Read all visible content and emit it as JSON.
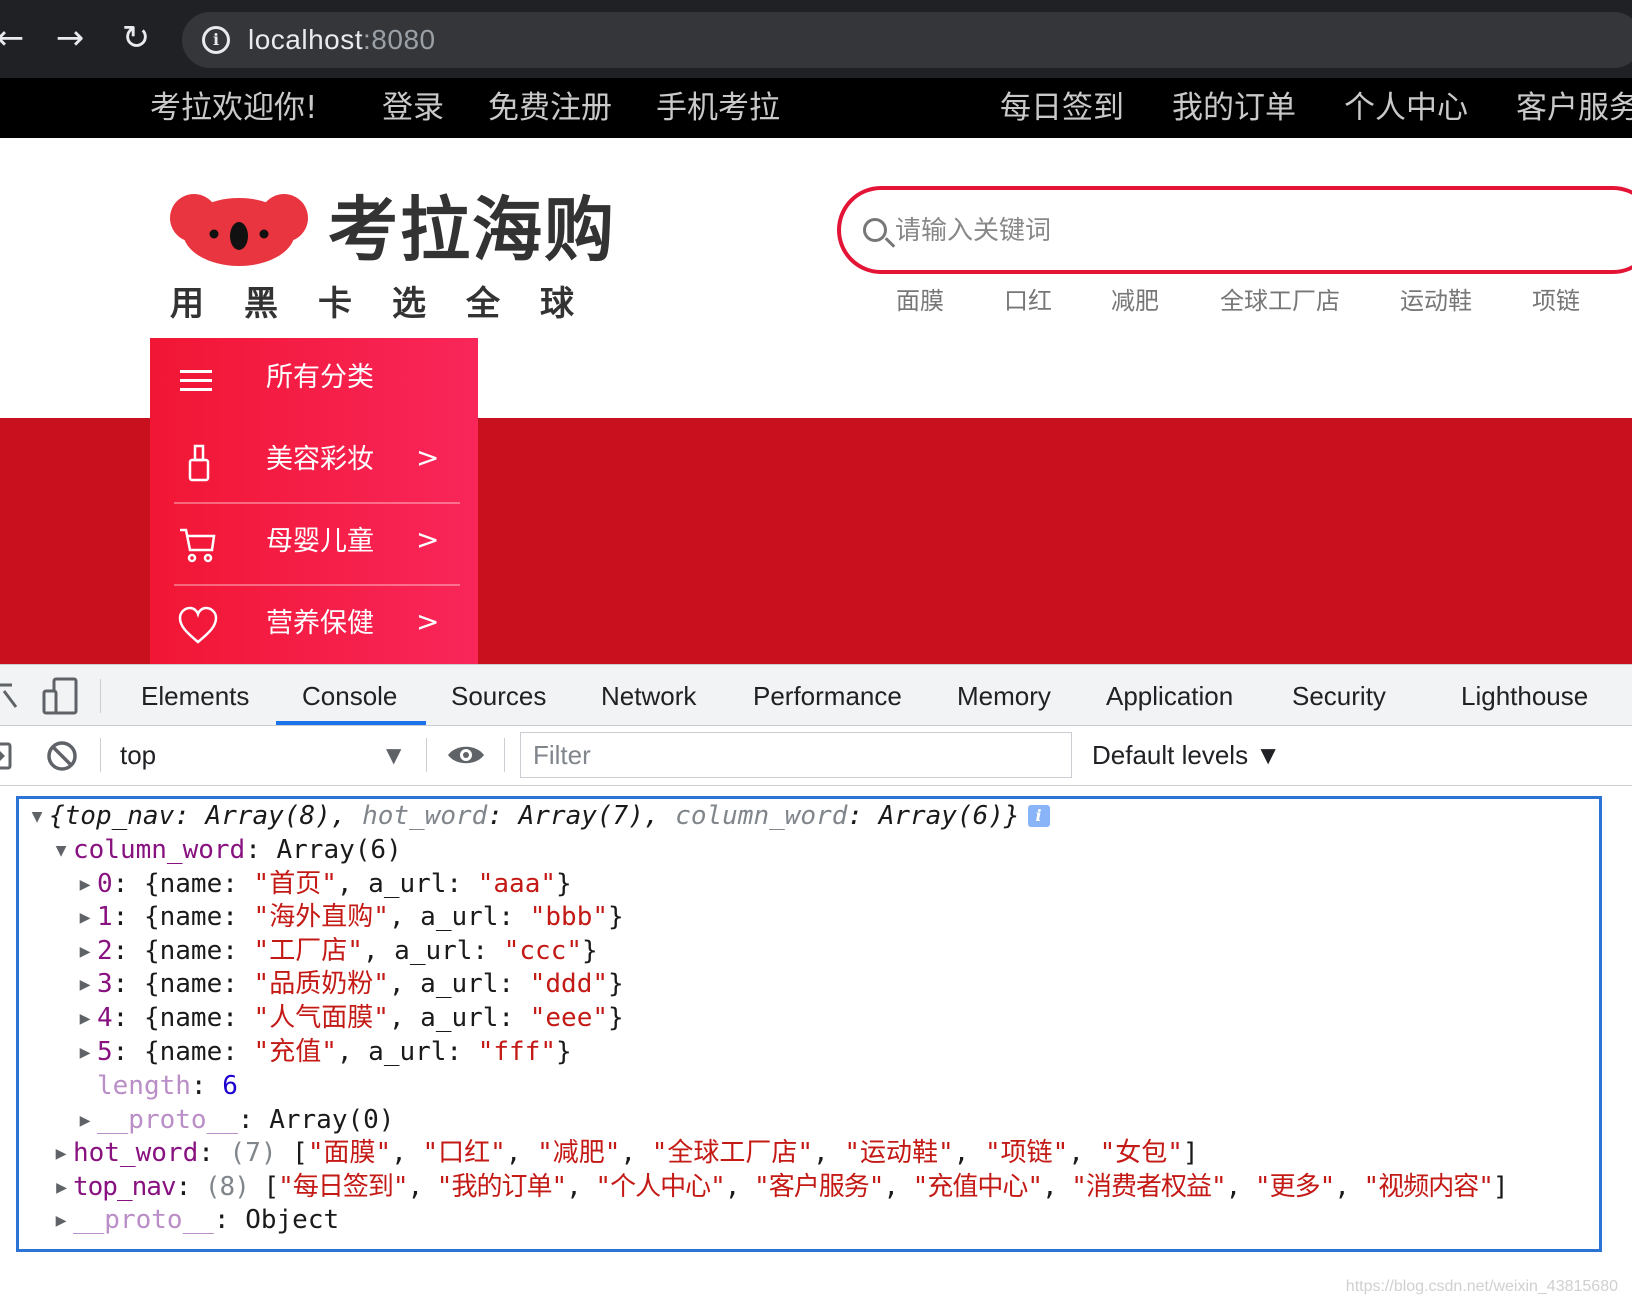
{
  "browser": {
    "url_host": "localhost",
    "url_port": ":8080"
  },
  "page": {
    "top_nav_left": [
      "考拉欢迎你!",
      "登录",
      "免费注册",
      "手机考拉"
    ],
    "top_nav_right": [
      "每日签到",
      "我的订单",
      "个人中心",
      "客户服务"
    ],
    "logo_title": "考拉海购",
    "logo_slogan": "用黑卡选全球",
    "search_placeholder": "请输入关键词",
    "hot_words": [
      "面膜",
      "口红",
      "减肥",
      "全球工厂店",
      "运动鞋",
      "项链"
    ],
    "category_title": "所有分类",
    "categories": [
      {
        "label": "美容彩妆",
        "icon": "bottle-icon"
      },
      {
        "label": "母婴儿童",
        "icon": "cart-icon"
      },
      {
        "label": "营养保健",
        "icon": "heart-icon"
      }
    ],
    "arrow": ">",
    "colors": {
      "brand_red": "#e31436",
      "banner_red": "#c8101e",
      "menu_gradient_start": "#f11634",
      "menu_gradient_end": "#f9265a"
    }
  },
  "devtools": {
    "tabs": [
      "Elements",
      "Console",
      "Sources",
      "Network",
      "Performance",
      "Memory",
      "Application",
      "Security",
      "Lighthouse"
    ],
    "active_tab": "Console",
    "context": "top",
    "filter_placeholder": "Filter",
    "levels": "Default levels ▼"
  },
  "console": {
    "summary": {
      "k1": "top_nav",
      "v1": "Array(8)",
      "k2": "hot_word",
      "v2": "Array(7)",
      "k3": "column_word",
      "v3": "Array(6)"
    },
    "column_word_key": "column_word",
    "column_word_val": "Array(6)",
    "items": [
      {
        "index": "0",
        "name": "\"首页\"",
        "url": "\"aaa\""
      },
      {
        "index": "1",
        "name": "\"海外直购\"",
        "url": "\"bbb\""
      },
      {
        "index": "2",
        "name": "\"工厂店\"",
        "url": "\"ccc\""
      },
      {
        "index": "3",
        "name": "\"品质奶粉\"",
        "url": "\"ddd\""
      },
      {
        "index": "4",
        "name": "\"人气面膜\"",
        "url": "\"eee\""
      },
      {
        "index": "5",
        "name": "\"充值\"",
        "url": "\"fff\""
      }
    ],
    "length_key": "length",
    "length_val": "6",
    "proto_key": "__proto__",
    "proto_array": "Array(0)",
    "hot_word_key": "hot_word",
    "hot_word_count": "(7)",
    "hot_word_values": [
      "\"面膜\"",
      "\"口红\"",
      "\"减肥\"",
      "\"全球工厂店\"",
      "\"运动鞋\"",
      "\"项链\"",
      "\"女包\""
    ],
    "top_nav_key": "top_nav",
    "top_nav_count": "(8)",
    "top_nav_values": [
      "\"每日签到\"",
      "\"我的订单\"",
      "\"个人中心\"",
      "\"客户服务\"",
      "\"充值中心\"",
      "\"消费者权益\"",
      "\"更多\"",
      "\"视频内容\""
    ],
    "proto_object": "Object"
  },
  "watermark": "https://blog.csdn.net/weixin_43815680"
}
